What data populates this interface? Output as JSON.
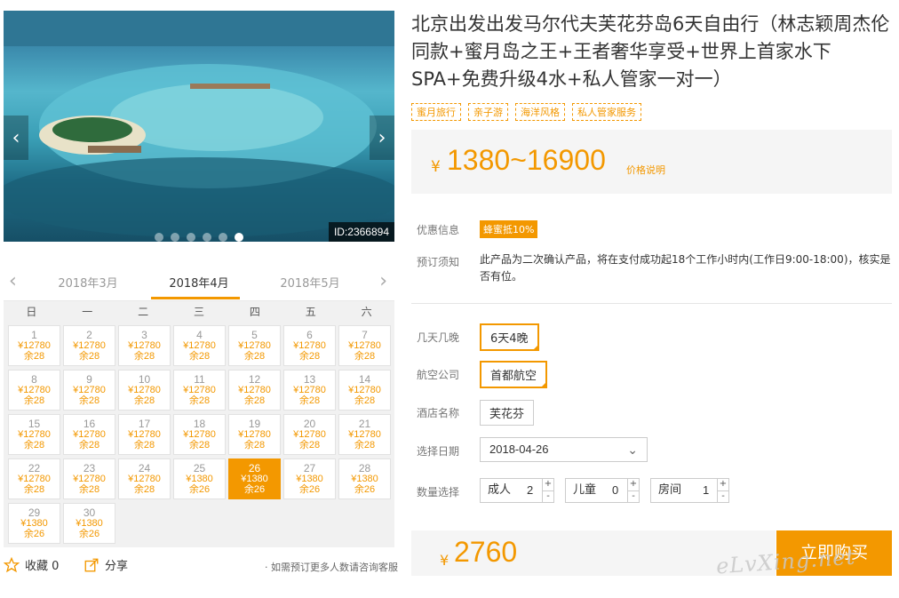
{
  "gallery": {
    "image_id": "ID:2366894",
    "prev_arrow": "‹",
    "next_arrow": "›",
    "dot_count": 6,
    "active_dot": 5
  },
  "calendar": {
    "prev_month": "2018年3月",
    "current_month": "2018年4月",
    "next_month": "2018年5月",
    "weekdays": [
      "日",
      "一",
      "二",
      "三",
      "四",
      "五",
      "六"
    ],
    "days": [
      {
        "day": "1",
        "price": "¥12780",
        "stock": "余28"
      },
      {
        "day": "2",
        "price": "¥12780",
        "stock": "余28"
      },
      {
        "day": "3",
        "price": "¥12780",
        "stock": "余28"
      },
      {
        "day": "4",
        "price": "¥12780",
        "stock": "余28"
      },
      {
        "day": "5",
        "price": "¥12780",
        "stock": "余28"
      },
      {
        "day": "6",
        "price": "¥12780",
        "stock": "余28"
      },
      {
        "day": "7",
        "price": "¥12780",
        "stock": "余28"
      },
      {
        "day": "8",
        "price": "¥12780",
        "stock": "余28"
      },
      {
        "day": "9",
        "price": "¥12780",
        "stock": "余28"
      },
      {
        "day": "10",
        "price": "¥12780",
        "stock": "余28"
      },
      {
        "day": "11",
        "price": "¥12780",
        "stock": "余28"
      },
      {
        "day": "12",
        "price": "¥12780",
        "stock": "余28"
      },
      {
        "day": "13",
        "price": "¥12780",
        "stock": "余28"
      },
      {
        "day": "14",
        "price": "¥12780",
        "stock": "余28"
      },
      {
        "day": "15",
        "price": "¥12780",
        "stock": "余28"
      },
      {
        "day": "16",
        "price": "¥12780",
        "stock": "余28"
      },
      {
        "day": "17",
        "price": "¥12780",
        "stock": "余28"
      },
      {
        "day": "18",
        "price": "¥12780",
        "stock": "余28"
      },
      {
        "day": "19",
        "price": "¥12780",
        "stock": "余28"
      },
      {
        "day": "20",
        "price": "¥12780",
        "stock": "余28"
      },
      {
        "day": "21",
        "price": "¥12780",
        "stock": "余28"
      },
      {
        "day": "22",
        "price": "¥12780",
        "stock": "余28"
      },
      {
        "day": "23",
        "price": "¥12780",
        "stock": "余28"
      },
      {
        "day": "24",
        "price": "¥12780",
        "stock": "余28"
      },
      {
        "day": "25",
        "price": "¥1380",
        "stock": "余26"
      },
      {
        "day": "26",
        "price": "¥1380",
        "stock": "余26",
        "selected": true
      },
      {
        "day": "27",
        "price": "¥1380",
        "stock": "余26"
      },
      {
        "day": "28",
        "price": "¥1380",
        "stock": "余26"
      },
      {
        "day": "29",
        "price": "¥1380",
        "stock": "余26"
      },
      {
        "day": "30",
        "price": "¥1380",
        "stock": "余26"
      }
    ]
  },
  "footer_left": {
    "favorite_label": "收藏 0",
    "share_label": "分享",
    "consult_text": "· 如需预订更多人数请咨询客服"
  },
  "product": {
    "title": "北京出发出发马尔代夫芙花芬岛6天自由行（林志颖周杰伦同款+蜜月岛之王+王者奢华享受+世界上首家水下SPA+免费升级4水+私人管家一对一）",
    "tags": [
      "蜜月旅行",
      "亲子游",
      "海洋风格",
      "私人管家服务"
    ],
    "price_symbol": "¥",
    "price_range": "1380~16900",
    "price_note": "价格说明"
  },
  "info": {
    "discount_label": "优惠信息",
    "discount_badge": "蜂蜜抵10%",
    "notice_label": "预订须知",
    "notice_text": "此产品为二次确认产品，将在支付成功起18个工作小时内(工作日9:00-18:00)，核实是否有位。"
  },
  "options": {
    "duration_label": "几天几晚",
    "duration_value": "6天4晚",
    "airline_label": "航空公司",
    "airline_value": "首都航空",
    "hotel_label": "酒店名称",
    "hotel_value": "芙花芬",
    "date_label": "选择日期",
    "date_value": "2018-04-26",
    "qty_label": "数量选择",
    "adult_label": "成人",
    "adult_value": "2",
    "child_label": "儿童",
    "child_value": "0",
    "room_label": "房间",
    "room_value": "1",
    "plus": "+",
    "minus": "-"
  },
  "purchase": {
    "total_symbol": "¥",
    "total": "2760",
    "buy_label": "立即购买",
    "watermark": "eLvXing.net"
  },
  "colors": {
    "accent": "#f39800",
    "sea_light": "#55b6cc",
    "sea_dark": "#164f66"
  }
}
